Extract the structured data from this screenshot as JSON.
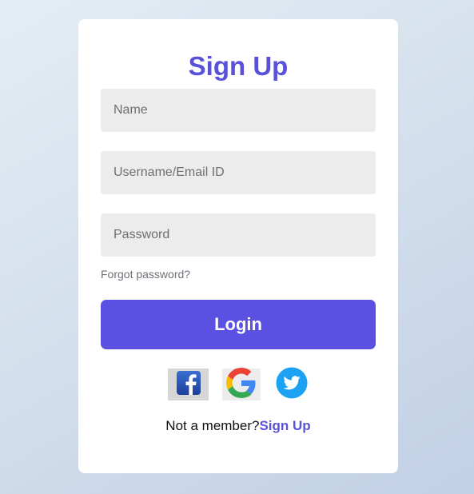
{
  "form": {
    "title": "Sign Up",
    "name_placeholder": "Name",
    "username_placeholder": "Username/Email ID",
    "password_placeholder": "Password",
    "forgot_label": "Forgot password?",
    "login_label": "Login"
  },
  "social": {
    "icons": [
      "facebook-icon",
      "google-icon",
      "twitter-icon"
    ]
  },
  "footer": {
    "prompt": "Not a member?",
    "signup_link": "Sign Up"
  },
  "colors": {
    "accent": "#5a51d9",
    "button": "#5a51e3",
    "field_bg": "#ececec"
  }
}
